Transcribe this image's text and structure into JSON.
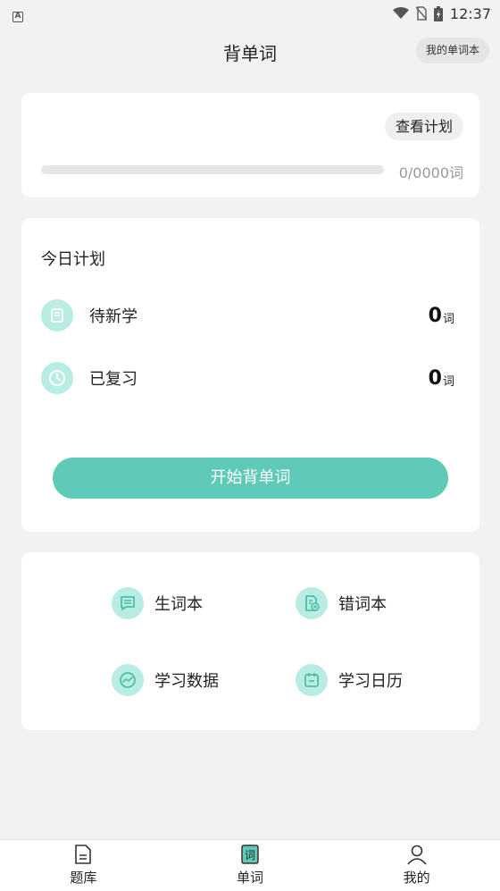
{
  "status_bar": {
    "time": "12:37",
    "left_icon": "A",
    "icons": [
      "wifi-icon",
      "no-sim-icon",
      "battery-charging-icon"
    ]
  },
  "header": {
    "title": "背单词",
    "my_wordbook_label": "我的单词本"
  },
  "progress_card": {
    "view_plan_label": "查看计划",
    "progress_text": "0/0000词",
    "progress_fraction": 0
  },
  "plan_card": {
    "title": "今日计划",
    "rows": [
      {
        "label": "待新学",
        "count": "0",
        "unit": "词",
        "icon": "notebook-icon"
      },
      {
        "label": "已复习",
        "count": "0",
        "unit": "词",
        "icon": "clock-icon"
      }
    ],
    "start_label": "开始背单词"
  },
  "tools": [
    {
      "label": "生词本",
      "icon": "message-list-icon"
    },
    {
      "label": "错词本",
      "icon": "error-document-icon"
    },
    {
      "label": "学习数据",
      "icon": "chart-line-icon"
    },
    {
      "label": "学习日历",
      "icon": "calendar-icon"
    }
  ],
  "bottom_nav": [
    {
      "label": "题库",
      "icon": "document-icon"
    },
    {
      "label": "单词",
      "icon": "word-card-icon",
      "active": true
    },
    {
      "label": "我的",
      "icon": "user-icon"
    }
  ],
  "colors": {
    "accent": "#5fcab7",
    "icon_bg": "#b9ece2",
    "background": "#f2f2f2"
  }
}
